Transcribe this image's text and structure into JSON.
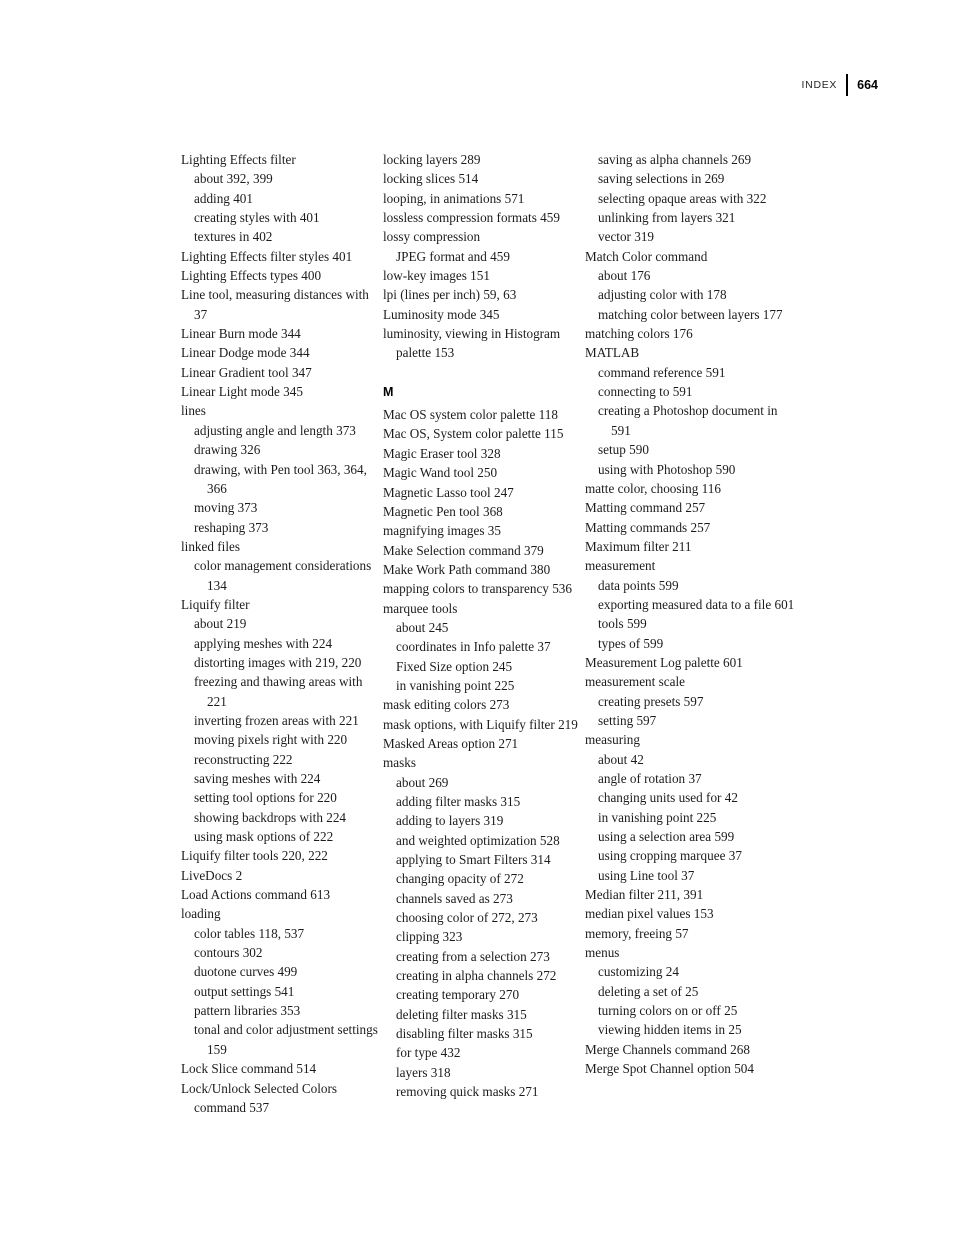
{
  "header": {
    "label": "INDEX",
    "folio": "664"
  },
  "columns": [
    {
      "name": "index-column-1",
      "blocks": [
        {
          "type": "entry",
          "level": 0,
          "text": "Lighting Effects filter"
        },
        {
          "type": "entry",
          "level": 1,
          "text": "about 392, 399"
        },
        {
          "type": "entry",
          "level": 1,
          "text": "adding 401"
        },
        {
          "type": "entry",
          "level": 1,
          "text": "creating styles with 401"
        },
        {
          "type": "entry",
          "level": 1,
          "text": "textures in 402"
        },
        {
          "type": "entry",
          "level": 0,
          "text": "Lighting Effects filter styles 401"
        },
        {
          "type": "entry",
          "level": 0,
          "text": "Lighting Effects types 400"
        },
        {
          "type": "entry",
          "level": 0,
          "text": "Line tool, measuring distances with 37"
        },
        {
          "type": "entry",
          "level": 0,
          "text": "Linear Burn mode 344"
        },
        {
          "type": "entry",
          "level": 0,
          "text": "Linear Dodge mode 344"
        },
        {
          "type": "entry",
          "level": 0,
          "text": "Linear Gradient tool 347"
        },
        {
          "type": "entry",
          "level": 0,
          "text": "Linear Light mode 345"
        },
        {
          "type": "entry",
          "level": 0,
          "text": "lines"
        },
        {
          "type": "entry",
          "level": 1,
          "text": "adjusting angle and length 373"
        },
        {
          "type": "entry",
          "level": 1,
          "text": "drawing 326"
        },
        {
          "type": "entry",
          "level": 1,
          "text": "drawing, with Pen tool 363, 364, 366"
        },
        {
          "type": "entry",
          "level": 1,
          "text": "moving 373"
        },
        {
          "type": "entry",
          "level": 1,
          "text": "reshaping 373"
        },
        {
          "type": "entry",
          "level": 0,
          "text": "linked files"
        },
        {
          "type": "entry",
          "level": 1,
          "text": "color management considerations 134"
        },
        {
          "type": "entry",
          "level": 0,
          "text": "Liquify filter"
        },
        {
          "type": "entry",
          "level": 1,
          "text": "about 219"
        },
        {
          "type": "entry",
          "level": 1,
          "text": "applying meshes with 224"
        },
        {
          "type": "entry",
          "level": 1,
          "text": "distorting images with 219, 220"
        },
        {
          "type": "entry",
          "level": 1,
          "text": "freezing and thawing areas with 221"
        },
        {
          "type": "entry",
          "level": 1,
          "text": "inverting frozen areas with 221"
        },
        {
          "type": "entry",
          "level": 1,
          "text": "moving pixels right with 220"
        },
        {
          "type": "entry",
          "level": 1,
          "text": "reconstructing 222"
        },
        {
          "type": "entry",
          "level": 1,
          "text": "saving meshes with 224"
        },
        {
          "type": "entry",
          "level": 1,
          "text": "setting tool options for 220"
        },
        {
          "type": "entry",
          "level": 1,
          "text": "showing backdrops with 224"
        },
        {
          "type": "entry",
          "level": 1,
          "text": "using mask options of 222"
        },
        {
          "type": "entry",
          "level": 0,
          "text": "Liquify filter tools 220, 222"
        },
        {
          "type": "entry",
          "level": 0,
          "text": "LiveDocs 2"
        },
        {
          "type": "entry",
          "level": 0,
          "text": "Load Actions command 613"
        },
        {
          "type": "entry",
          "level": 0,
          "text": "loading"
        },
        {
          "type": "entry",
          "level": 1,
          "text": "color tables 118, 537"
        },
        {
          "type": "entry",
          "level": 1,
          "text": "contours 302"
        },
        {
          "type": "entry",
          "level": 1,
          "text": "duotone curves 499"
        },
        {
          "type": "entry",
          "level": 1,
          "text": "output settings 541"
        },
        {
          "type": "entry",
          "level": 1,
          "text": "pattern libraries 353"
        },
        {
          "type": "entry",
          "level": 1,
          "text": "tonal and color adjustment settings 159"
        },
        {
          "type": "entry",
          "level": 0,
          "text": "Lock Slice command 514"
        },
        {
          "type": "entry",
          "level": 0,
          "text": "Lock/Unlock Selected Colors command 537"
        }
      ]
    },
    {
      "name": "index-column-2",
      "blocks": [
        {
          "type": "entry",
          "level": 0,
          "text": "locking layers 289"
        },
        {
          "type": "entry",
          "level": 0,
          "text": "locking slices 514"
        },
        {
          "type": "entry",
          "level": 0,
          "text": "looping, in animations 571"
        },
        {
          "type": "entry",
          "level": 0,
          "text": "lossless compression formats 459"
        },
        {
          "type": "entry",
          "level": 0,
          "text": "lossy compression"
        },
        {
          "type": "entry",
          "level": 1,
          "text": "JPEG format and 459"
        },
        {
          "type": "entry",
          "level": 0,
          "text": "low-key images 151"
        },
        {
          "type": "entry",
          "level": 0,
          "text": "lpi (lines per inch) 59, 63"
        },
        {
          "type": "entry",
          "level": 0,
          "text": "Luminosity mode 345"
        },
        {
          "type": "entry",
          "level": 0,
          "text": "luminosity, viewing in Histogram palette 153"
        },
        {
          "type": "letter",
          "text": "M"
        },
        {
          "type": "entry",
          "level": 0,
          "text": "Mac OS system color palette 118"
        },
        {
          "type": "entry",
          "level": 0,
          "text": "Mac OS, System color palette 115"
        },
        {
          "type": "entry",
          "level": 0,
          "text": "Magic Eraser tool 328"
        },
        {
          "type": "entry",
          "level": 0,
          "text": "Magic Wand tool 250"
        },
        {
          "type": "entry",
          "level": 0,
          "text": "Magnetic Lasso tool 247"
        },
        {
          "type": "entry",
          "level": 0,
          "text": "Magnetic Pen tool 368"
        },
        {
          "type": "entry",
          "level": 0,
          "text": "magnifying images 35"
        },
        {
          "type": "entry",
          "level": 0,
          "text": "Make Selection command 379"
        },
        {
          "type": "entry",
          "level": 0,
          "text": "Make Work Path command 380"
        },
        {
          "type": "entry",
          "level": 0,
          "text": "mapping colors to transparency 536"
        },
        {
          "type": "entry",
          "level": 0,
          "text": "marquee tools"
        },
        {
          "type": "entry",
          "level": 1,
          "text": "about 245"
        },
        {
          "type": "entry",
          "level": 1,
          "text": "coordinates in Info palette 37"
        },
        {
          "type": "entry",
          "level": 1,
          "text": "Fixed Size option 245"
        },
        {
          "type": "entry",
          "level": 1,
          "text": "in vanishing point 225"
        },
        {
          "type": "entry",
          "level": 0,
          "text": "mask editing colors 273"
        },
        {
          "type": "entry",
          "level": 0,
          "text": "mask options, with Liquify filter 219"
        },
        {
          "type": "entry",
          "level": 0,
          "text": "Masked Areas option 271"
        },
        {
          "type": "entry",
          "level": 0,
          "text": "masks"
        },
        {
          "type": "entry",
          "level": 1,
          "text": "about 269"
        },
        {
          "type": "entry",
          "level": 1,
          "text": "adding filter masks 315"
        },
        {
          "type": "entry",
          "level": 1,
          "text": "adding to layers 319"
        },
        {
          "type": "entry",
          "level": 1,
          "text": "and weighted optimization 528"
        },
        {
          "type": "entry",
          "level": 1,
          "text": "applying to Smart Filters 314"
        },
        {
          "type": "entry",
          "level": 1,
          "text": "changing opacity of 272"
        },
        {
          "type": "entry",
          "level": 1,
          "text": "channels saved as 273"
        },
        {
          "type": "entry",
          "level": 1,
          "text": "choosing color of 272, 273"
        },
        {
          "type": "entry",
          "level": 1,
          "text": "clipping 323"
        },
        {
          "type": "entry",
          "level": 1,
          "text": "creating from a selection 273"
        },
        {
          "type": "entry",
          "level": 1,
          "text": "creating in alpha channels 272"
        },
        {
          "type": "entry",
          "level": 1,
          "text": "creating temporary 270"
        },
        {
          "type": "entry",
          "level": 1,
          "text": "deleting filter masks 315"
        },
        {
          "type": "entry",
          "level": 1,
          "text": "disabling filter masks 315"
        },
        {
          "type": "entry",
          "level": 1,
          "text": "for type 432"
        },
        {
          "type": "entry",
          "level": 1,
          "text": "layers 318"
        },
        {
          "type": "entry",
          "level": 1,
          "text": "removing quick masks 271"
        }
      ]
    },
    {
      "name": "index-column-3",
      "blocks": [
        {
          "type": "entry",
          "level": 1,
          "text": "saving as alpha channels 269"
        },
        {
          "type": "entry",
          "level": 1,
          "text": "saving selections in 269"
        },
        {
          "type": "entry",
          "level": 1,
          "text": "selecting opaque areas with 322"
        },
        {
          "type": "entry",
          "level": 1,
          "text": "unlinking from layers 321"
        },
        {
          "type": "entry",
          "level": 1,
          "text": "vector 319"
        },
        {
          "type": "entry",
          "level": 0,
          "text": "Match Color command"
        },
        {
          "type": "entry",
          "level": 1,
          "text": "about 176"
        },
        {
          "type": "entry",
          "level": 1,
          "text": "adjusting color with 178"
        },
        {
          "type": "entry",
          "level": 1,
          "text": "matching color between layers 177"
        },
        {
          "type": "entry",
          "level": 0,
          "text": "matching colors 176"
        },
        {
          "type": "entry",
          "level": 0,
          "text": "MATLAB"
        },
        {
          "type": "entry",
          "level": 1,
          "text": "command reference 591"
        },
        {
          "type": "entry",
          "level": 1,
          "text": "connecting to 591"
        },
        {
          "type": "entry",
          "level": 1,
          "text": "creating a Photoshop document in 591"
        },
        {
          "type": "entry",
          "level": 1,
          "text": "setup 590"
        },
        {
          "type": "entry",
          "level": 1,
          "text": "using with Photoshop 590"
        },
        {
          "type": "entry",
          "level": 0,
          "text": "matte color, choosing 116"
        },
        {
          "type": "entry",
          "level": 0,
          "text": "Matting command 257"
        },
        {
          "type": "entry",
          "level": 0,
          "text": "Matting commands 257"
        },
        {
          "type": "entry",
          "level": 0,
          "text": "Maximum filter 211"
        },
        {
          "type": "entry",
          "level": 0,
          "text": "measurement"
        },
        {
          "type": "entry",
          "level": 1,
          "text": "data points 599"
        },
        {
          "type": "entry",
          "level": 1,
          "text": "exporting measured data to a file 601"
        },
        {
          "type": "entry",
          "level": 1,
          "text": "tools 599"
        },
        {
          "type": "entry",
          "level": 1,
          "text": "types of 599"
        },
        {
          "type": "entry",
          "level": 0,
          "text": "Measurement Log palette 601"
        },
        {
          "type": "entry",
          "level": 0,
          "text": "measurement scale"
        },
        {
          "type": "entry",
          "level": 1,
          "text": "creating presets 597"
        },
        {
          "type": "entry",
          "level": 1,
          "text": "setting 597"
        },
        {
          "type": "entry",
          "level": 0,
          "text": "measuring"
        },
        {
          "type": "entry",
          "level": 1,
          "text": "about 42"
        },
        {
          "type": "entry",
          "level": 1,
          "text": "angle of rotation 37"
        },
        {
          "type": "entry",
          "level": 1,
          "text": "changing units used for 42"
        },
        {
          "type": "entry",
          "level": 1,
          "text": "in vanishing point 225"
        },
        {
          "type": "entry",
          "level": 1,
          "text": "using a selection area 599"
        },
        {
          "type": "entry",
          "level": 1,
          "text": "using cropping marquee 37"
        },
        {
          "type": "entry",
          "level": 1,
          "text": "using Line tool 37"
        },
        {
          "type": "entry",
          "level": 0,
          "text": "Median filter 211, 391"
        },
        {
          "type": "entry",
          "level": 0,
          "text": "median pixel values 153"
        },
        {
          "type": "entry",
          "level": 0,
          "text": "memory, freeing 57"
        },
        {
          "type": "entry",
          "level": 0,
          "text": "menus"
        },
        {
          "type": "entry",
          "level": 1,
          "text": "customizing 24"
        },
        {
          "type": "entry",
          "level": 1,
          "text": "deleting a set of 25"
        },
        {
          "type": "entry",
          "level": 1,
          "text": "turning colors on or off 25"
        },
        {
          "type": "entry",
          "level": 1,
          "text": "viewing hidden items in 25"
        },
        {
          "type": "entry",
          "level": 0,
          "text": "Merge Channels command 268"
        },
        {
          "type": "entry",
          "level": 0,
          "text": "Merge Spot Channel option 504"
        }
      ]
    }
  ]
}
